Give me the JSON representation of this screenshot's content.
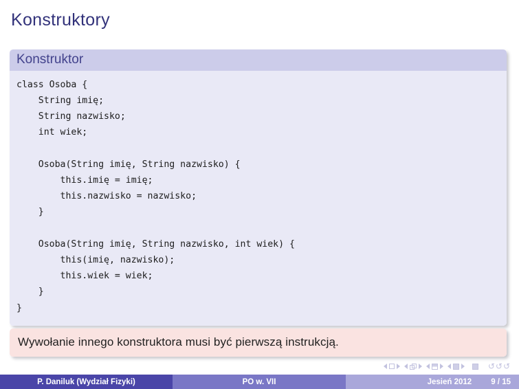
{
  "slide": {
    "title": "Konstruktory"
  },
  "code_block": {
    "heading": "Konstruktor",
    "lines": [
      "class Osoba {",
      "    String imię;",
      "    String nazwisko;",
      "    int wiek;",
      "",
      "    Osoba(String imię, String nazwisko) {",
      "        this.imię = imię;",
      "        this.nazwisko = nazwisko;",
      "    }",
      "",
      "    Osoba(String imię, String nazwisko, int wiek) {",
      "        this(imię, nazwisko);",
      "        this.wiek = wiek;",
      "    }",
      "}"
    ],
    "code_text": "class Osoba {\n    String imię;\n    String nazwisko;\n    int wiek;\n\n    Osoba(String imię, String nazwisko) {\n        this.imię = imię;\n        this.nazwisko = nazwisko;\n    }\n\n    Osoba(String imię, String nazwisko, int wiek) {\n        this(imię, nazwisko);\n        this.wiek = wiek;\n    }\n}"
  },
  "alert_block": {
    "text": "Wywołanie innego konstruktora musi być pierwszą instrukcją."
  },
  "footer": {
    "author": "P. Daniluk  (Wydział Fizyki)",
    "title": "PO w. VII",
    "date": "Jesień 2012",
    "page": "9 / 15"
  },
  "colors": {
    "title_text": "#32327a",
    "block_head_bg": "#ccccea",
    "block_body_bg": "#e9e9f6",
    "alert_bg": "#fae3e1",
    "foot_author_bg": "#4a45a8",
    "foot_title_bg": "#7a77c6",
    "foot_date_bg": "#a9a7da"
  }
}
